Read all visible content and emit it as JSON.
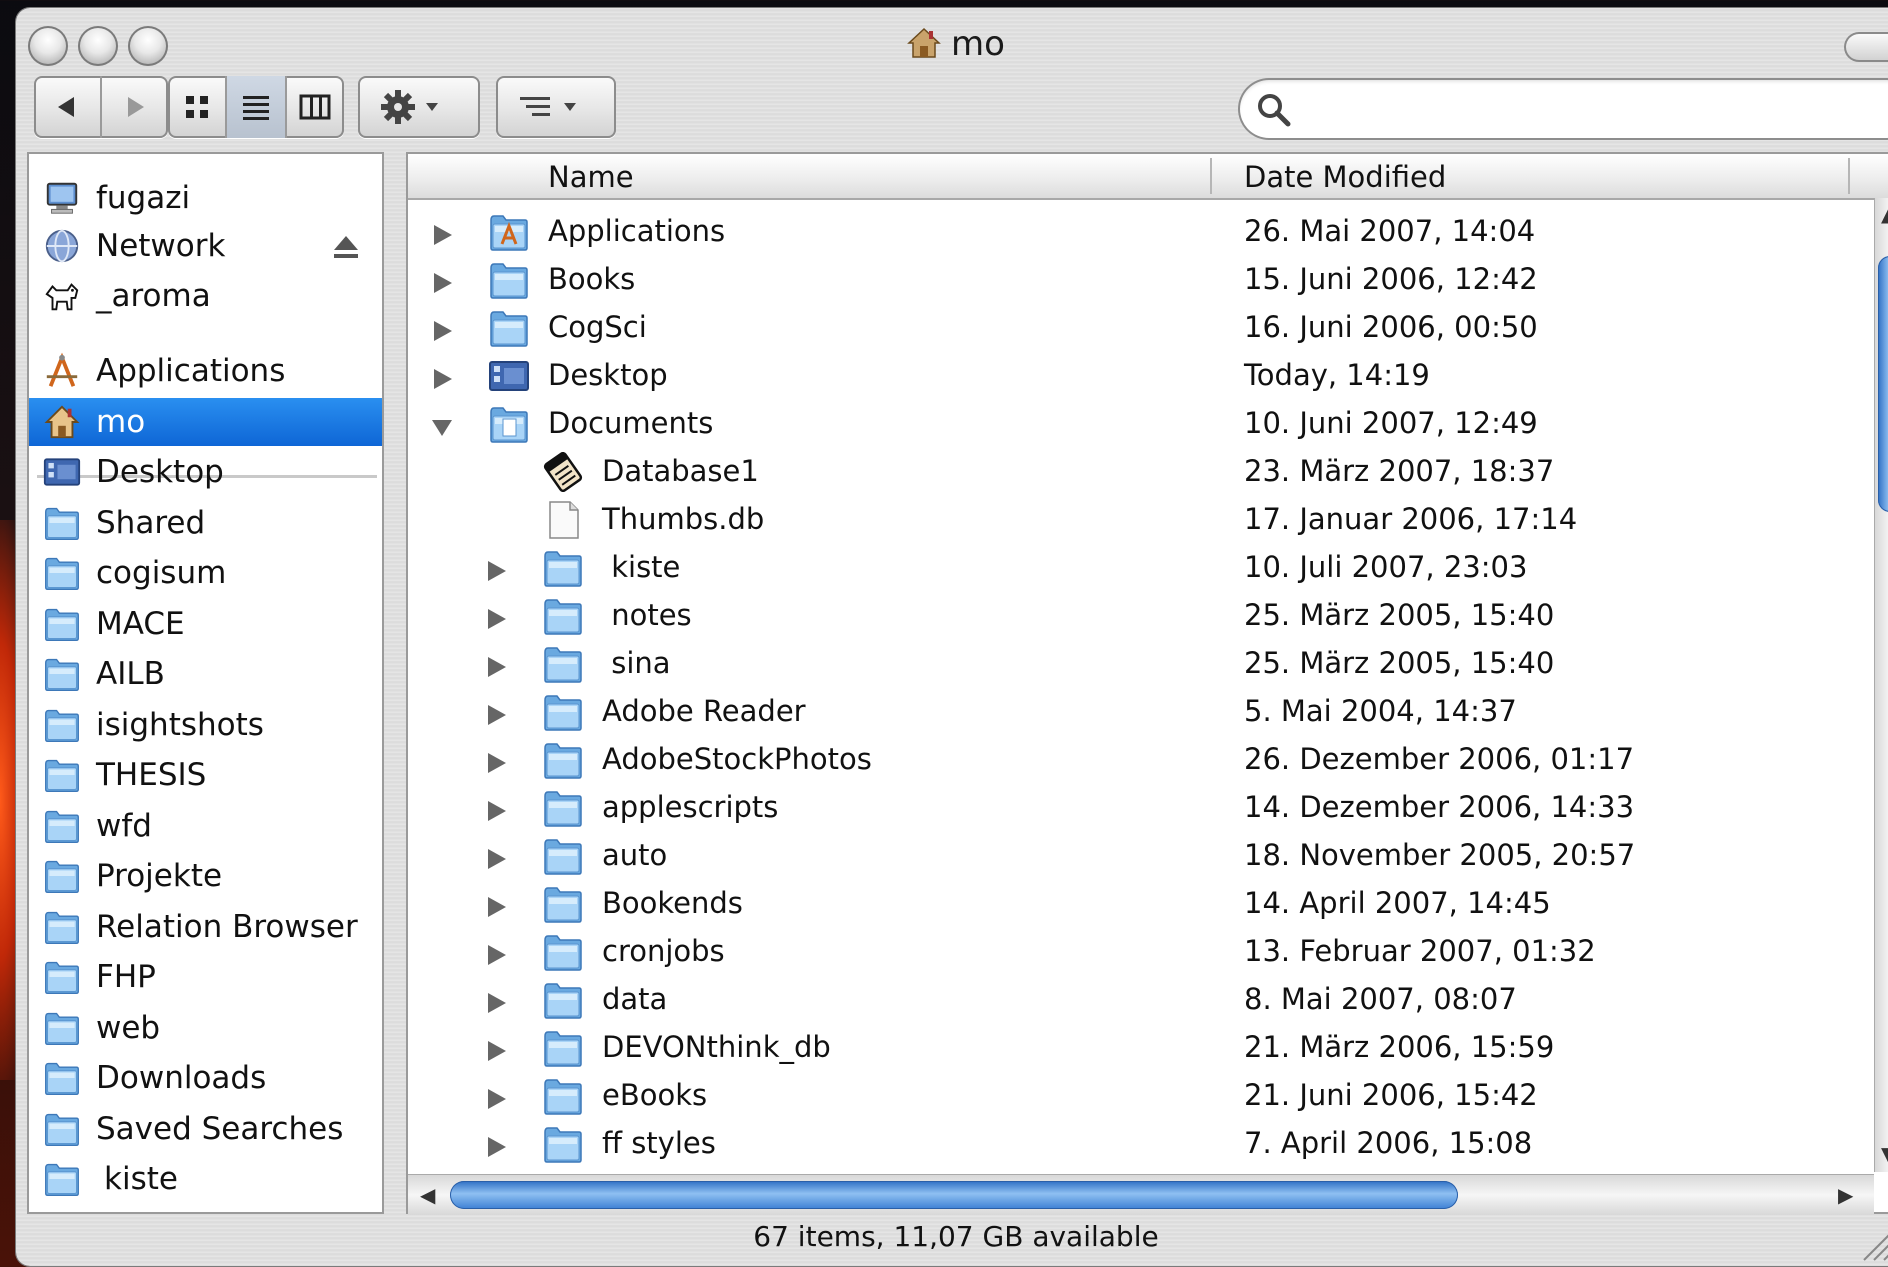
{
  "window": {
    "title": "mo",
    "status_text": "67 items, 11,07 GB available"
  },
  "toolbar": {
    "back_icon": "back-arrow-icon",
    "forward_icon": "forward-arrow-icon",
    "view_modes": [
      "icon-view-icon",
      "list-view-icon",
      "column-view-icon"
    ],
    "active_view": "list",
    "action_icon": "gear-icon",
    "arrange_icon": "arrange-icon",
    "search_value": "",
    "search_placeholder": ""
  },
  "sidebar": {
    "devices": [
      {
        "label": "fugazi",
        "icon": "computer-icon"
      },
      {
        "label": "Network",
        "icon": "network-globe-icon"
      },
      {
        "label": "_aroma",
        "icon": "dog-icon"
      }
    ],
    "places": [
      {
        "label": "Applications",
        "icon": "applications-icon"
      },
      {
        "label": "mo",
        "icon": "home-icon",
        "selected": true
      },
      {
        "label": "Desktop",
        "icon": "desktop-icon"
      },
      {
        "label": "Shared",
        "icon": "folder-icon"
      },
      {
        "label": "cogisum",
        "icon": "folder-icon"
      },
      {
        "label": "MACE",
        "icon": "folder-icon"
      },
      {
        "label": "AILB",
        "icon": "folder-icon"
      },
      {
        "label": "isightshots",
        "icon": "folder-icon"
      },
      {
        "label": "THESIS",
        "icon": "folder-icon"
      },
      {
        "label": "wfd",
        "icon": "folder-icon"
      },
      {
        "label": "Projekte",
        "icon": "folder-icon"
      },
      {
        "label": "Relation Browser",
        "icon": "folder-icon"
      },
      {
        "label": "FHP",
        "icon": "folder-icon"
      },
      {
        "label": "web",
        "icon": "folder-icon"
      },
      {
        "label": "Downloads",
        "icon": "folder-icon"
      },
      {
        "label": "Saved Searches",
        "icon": "folder-icon"
      },
      {
        "label": "kiste",
        "icon": "folder-icon"
      }
    ]
  },
  "list": {
    "columns": {
      "name": "Name",
      "date": "Date Modified"
    },
    "rows": [
      {
        "name": "Applications",
        "date": "26. Mai 2007, 14:04",
        "level": 0,
        "disclosure": "collapsed",
        "icon": "applications-folder-icon"
      },
      {
        "name": "Books",
        "date": "15. Juni 2006, 12:42",
        "level": 0,
        "disclosure": "collapsed",
        "icon": "folder-icon"
      },
      {
        "name": "CogSci",
        "date": "16. Juni 2006, 00:50",
        "level": 0,
        "disclosure": "collapsed",
        "icon": "folder-icon"
      },
      {
        "name": "Desktop",
        "date": "Today, 14:19",
        "level": 0,
        "disclosure": "collapsed",
        "icon": "desktop-icon"
      },
      {
        "name": "Documents",
        "date": "10. Juni 2007, 12:49",
        "level": 0,
        "disclosure": "expanded",
        "icon": "documents-folder-icon"
      },
      {
        "name": "Database1",
        "date": "23. März 2007, 18:37",
        "level": 1,
        "disclosure": "none",
        "icon": "database-icon"
      },
      {
        "name": "Thumbs.db",
        "date": "17. Januar 2006, 17:14",
        "level": 1,
        "disclosure": "none",
        "icon": "document-icon"
      },
      {
        "name": " kiste",
        "date": "10. Juli 2007, 23:03",
        "level": 1,
        "disclosure": "collapsed",
        "icon": "folder-icon"
      },
      {
        "name": " notes",
        "date": "25. März 2005, 15:40",
        "level": 1,
        "disclosure": "collapsed",
        "icon": "folder-icon"
      },
      {
        "name": " sina",
        "date": "25. März 2005, 15:40",
        "level": 1,
        "disclosure": "collapsed",
        "icon": "folder-icon"
      },
      {
        "name": "Adobe Reader",
        "date": "5. Mai 2004, 14:37",
        "level": 1,
        "disclosure": "collapsed",
        "icon": "folder-icon"
      },
      {
        "name": "AdobeStockPhotos",
        "date": "26. Dezember 2006, 01:17",
        "level": 1,
        "disclosure": "collapsed",
        "icon": "folder-icon"
      },
      {
        "name": "applescripts",
        "date": "14. Dezember 2006, 14:33",
        "level": 1,
        "disclosure": "collapsed",
        "icon": "folder-icon"
      },
      {
        "name": "auto",
        "date": "18. November 2005, 20:57",
        "level": 1,
        "disclosure": "collapsed",
        "icon": "folder-icon"
      },
      {
        "name": "Bookends",
        "date": "14. April 2007, 14:45",
        "level": 1,
        "disclosure": "collapsed",
        "icon": "folder-icon"
      },
      {
        "name": "cronjobs",
        "date": "13. Februar 2007, 01:32",
        "level": 1,
        "disclosure": "collapsed",
        "icon": "folder-icon"
      },
      {
        "name": "data",
        "date": "8. Mai 2007, 08:07",
        "level": 1,
        "disclosure": "collapsed",
        "icon": "folder-icon"
      },
      {
        "name": "DEVONthink_db",
        "date": "21. März 2006, 15:59",
        "level": 1,
        "disclosure": "collapsed",
        "icon": "folder-icon"
      },
      {
        "name": "eBooks",
        "date": "21. Juni 2006, 15:42",
        "level": 1,
        "disclosure": "collapsed",
        "icon": "folder-icon"
      },
      {
        "name": "ff styles",
        "date": "7. April 2006, 15:08",
        "level": 1,
        "disclosure": "collapsed",
        "icon": "folder-icon"
      }
    ]
  },
  "colors": {
    "selection": "#0e66d6",
    "folder_blue": "#8fc3ee",
    "scroll_thumb": "#3d80d4"
  }
}
